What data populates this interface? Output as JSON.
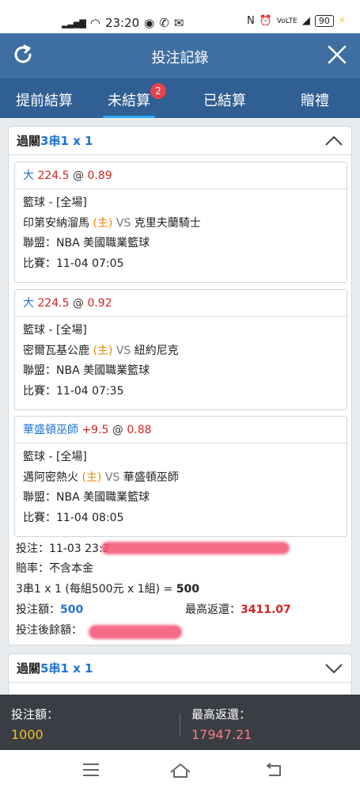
{
  "status_bar": {
    "time": "23:20",
    "battery": "90"
  },
  "header": {
    "title": "投注記錄"
  },
  "tabs": [
    {
      "label": "提前結算"
    },
    {
      "label": "未結算",
      "badge": "2"
    },
    {
      "label": "已結算"
    },
    {
      "label": "贈禮"
    }
  ],
  "bets": [
    {
      "type_prefix": "過關",
      "type": "3串1 x 1",
      "legs": [
        {
          "selection": "大",
          "line": "224.5",
          "at": "@",
          "odds": "0.89",
          "sport": "籃球 - [全場]",
          "home": "印第安納溜馬",
          "home_tag": "(主)",
          "vs": "VS",
          "away": "克里夫蘭騎士",
          "league": "聯盟：NBA 美國職業籃球",
          "match": "比賽：11-04 07:05"
        },
        {
          "selection": "大",
          "line": "224.5",
          "at": "@",
          "odds": "0.92",
          "sport": "籃球 - [全場]",
          "home": "密爾瓦基公鹿",
          "home_tag": "(主)",
          "vs": "VS",
          "away": "紐約尼克",
          "league": "聯盟：NBA 美國職業籃球",
          "match": "比賽：11-04 07:35"
        },
        {
          "selection": "華盛頓巫師",
          "line": "+9.5",
          "at": "@",
          "odds": "0.88",
          "sport": "籃球 - [全場]",
          "home": "邁阿密熱火",
          "home_tag": "(主)",
          "vs": "VS",
          "away": "華盛頓巫師",
          "league": "聯盟：NBA 美國職業籃球",
          "match": "比賽：11-04 08:05"
        }
      ],
      "bet_time": "投注：11-03 23:2",
      "odds_type": "賠率：不含本金",
      "combo": "3串1 x 1 (每組500元 x 1組) = ",
      "combo_total": "500",
      "stake_label": "投注額：",
      "stake": "500",
      "max_return_label": "最高返還：",
      "max_return": "3411.07",
      "balance_label": "投注後餘額："
    },
    {
      "type_prefix": "過關",
      "type": "5串1 x 1"
    }
  ],
  "footer": {
    "stake_label": "投注額：",
    "stake": "1000",
    "max_return_label": "最高返還：",
    "max_return": "17947.21"
  }
}
